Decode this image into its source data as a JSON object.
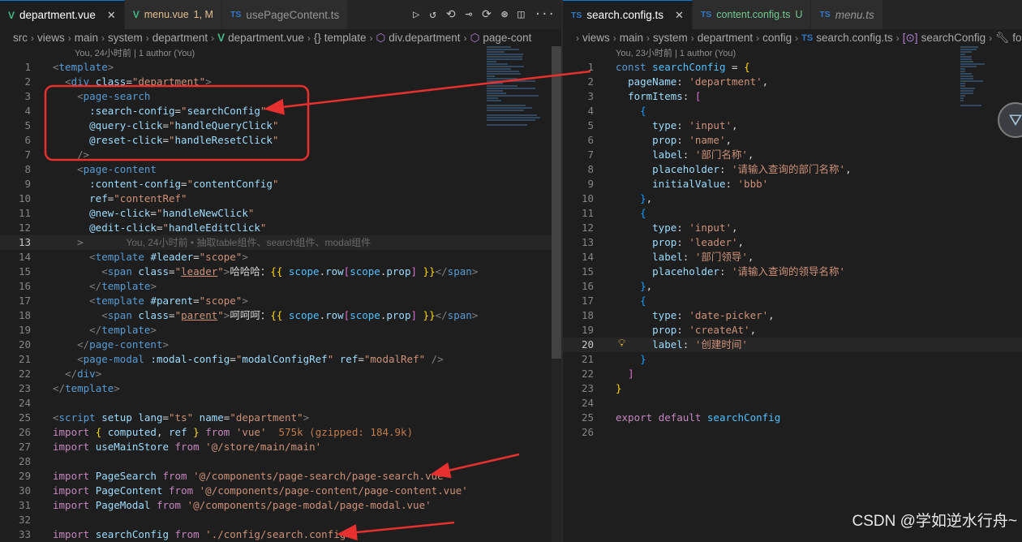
{
  "left": {
    "tabs": [
      {
        "label": "department.vue",
        "suffix": "",
        "icon": "vue-file-icon",
        "active": true
      },
      {
        "label": "menu.vue",
        "suffix": "1, M",
        "icon": "vue-file-icon",
        "active": false
      },
      {
        "label": "usePageContent.ts",
        "suffix": "",
        "icon": "ts-file-icon",
        "active": false
      }
    ],
    "breadcrumb": [
      "src",
      "views",
      "main",
      "system",
      "department",
      "department.vue",
      "{} template",
      "div.department",
      "page-cont"
    ],
    "blame": "You, 24小时前 | 1 author (You)",
    "inline_blame": "You, 24小时前 • 抽取table组件、search组件、modal组件",
    "import_size": "575k (gzipped: 184.9k)",
    "current_line": "13"
  },
  "right": {
    "tabs": [
      {
        "label": "search.config.ts",
        "suffix": "",
        "icon": "ts-file-icon",
        "active": true
      },
      {
        "label": "content.config.ts",
        "suffix": "U",
        "icon": "ts-file-icon",
        "active": false
      },
      {
        "label": "menu.ts",
        "suffix": "",
        "icon": "ts-file-icon",
        "active": false
      }
    ],
    "breadcrumb": [
      "views",
      "main",
      "system",
      "department",
      "config",
      "search.config.ts",
      "searchConfig",
      "fo"
    ],
    "blame": "You, 23小时前 | 1 author (You)",
    "current_line": "20"
  },
  "watermark": "CSDN @学如逆水行舟~",
  "colors": {
    "annotation_red": "#e8302f",
    "vue_green": "#41b883",
    "ts_blue": "#3178c6"
  }
}
